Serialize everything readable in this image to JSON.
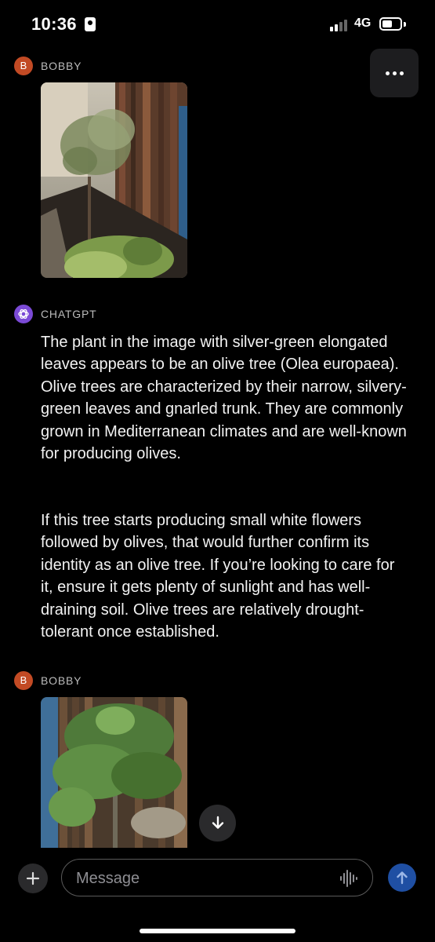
{
  "status_bar": {
    "time": "10:36",
    "network": "4G"
  },
  "thread": [
    {
      "author": "BOBBY",
      "avatar_letter": "B",
      "avatar_color": "#c24a24",
      "type": "image"
    },
    {
      "author": "CHATGPT",
      "avatar_color": "#7b4ad6",
      "type": "text",
      "paragraphs": [
        "The plant in the image with silver-green elongated leaves appears to be an olive tree (Olea europaea). Olive trees are characterized by their narrow, silvery-green leaves and gnarled trunk. They are commonly grown in Mediterranean climates and are well-known for producing olives.",
        "If this tree starts producing small white flowers followed by olives, that would further confirm its identity as an olive tree. If you’re looking to care for it, ensure it gets plenty of sunlight and has well-draining soil. Olive trees are relatively drought-tolerant once established."
      ]
    },
    {
      "author": "BOBBY",
      "avatar_letter": "B",
      "avatar_color": "#c24a24",
      "type": "image"
    }
  ],
  "composer": {
    "placeholder": "Message"
  },
  "icons": {
    "more": "ellipsis-icon",
    "scroll": "arrow-down-icon",
    "plus": "plus-icon",
    "voice": "voice-waveform-icon",
    "send": "arrow-up-icon"
  },
  "colors": {
    "send": "#1f4fa3",
    "user_avatar": "#c24a24",
    "bot_avatar": "#7b4ad6"
  }
}
